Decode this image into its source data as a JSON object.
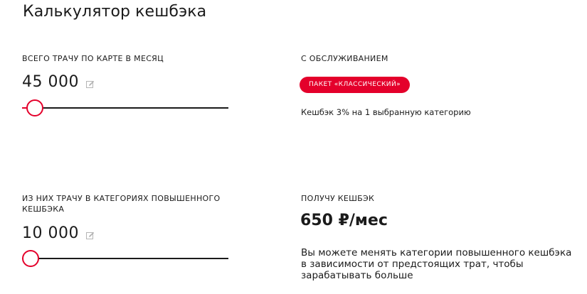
{
  "header": {
    "title": "Калькулятор кешбэка"
  },
  "spend": {
    "label": "Всего трачу по карте в месяц",
    "value": "45 000",
    "slider_level": 0.05
  },
  "category_spend": {
    "label": "Из них трачу в категориях повышенного кешбэка",
    "value": "10 000",
    "slider_level": 0.02
  },
  "service": {
    "label": "С обслуживанием",
    "package_badge": "Пакет «Классический»",
    "note": "Кешбэк 3% на 1 выбранную категорию"
  },
  "result": {
    "label": "Получу кешбэк",
    "value": "650 ₽/мес",
    "description": "Вы можете менять категории повышенного кешбэка в зависимости от предстоящих трат, чтобы зарабатывать больше"
  },
  "icons": {
    "edit": "edit-icon"
  },
  "colors": {
    "accent": "#e4002b",
    "text": "#1b1b1b"
  }
}
